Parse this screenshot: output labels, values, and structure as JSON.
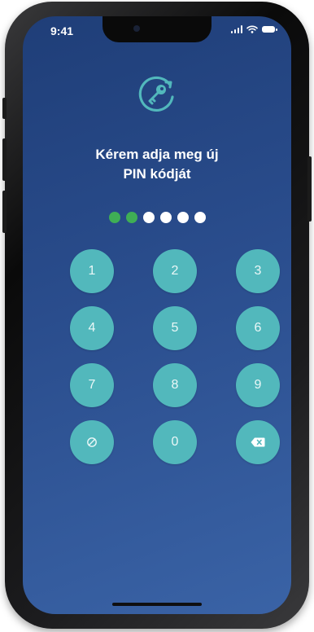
{
  "status_bar": {
    "time": "9:41",
    "icons": [
      "signal-icon",
      "wifi-icon",
      "battery-icon"
    ]
  },
  "logo": {
    "icon": "key-refresh-icon"
  },
  "prompt": {
    "line1": "Kérem adja meg új",
    "line2": "PIN kódját"
  },
  "pin_progress": {
    "entered": 2,
    "total": 6,
    "filled_color": "#3fae55",
    "empty_color": "#ffffff"
  },
  "keypad": {
    "keys": [
      "1",
      "2",
      "3",
      "4",
      "5",
      "6",
      "7",
      "8",
      "9",
      "",
      "0",
      ""
    ],
    "clear_icon": "clear-icon",
    "backspace_icon": "backspace-icon",
    "key_color": "#52b8bc"
  },
  "colors": {
    "background_top": "#1f3e78",
    "background_bottom": "#3a63a6",
    "accent": "#52b8bc"
  }
}
